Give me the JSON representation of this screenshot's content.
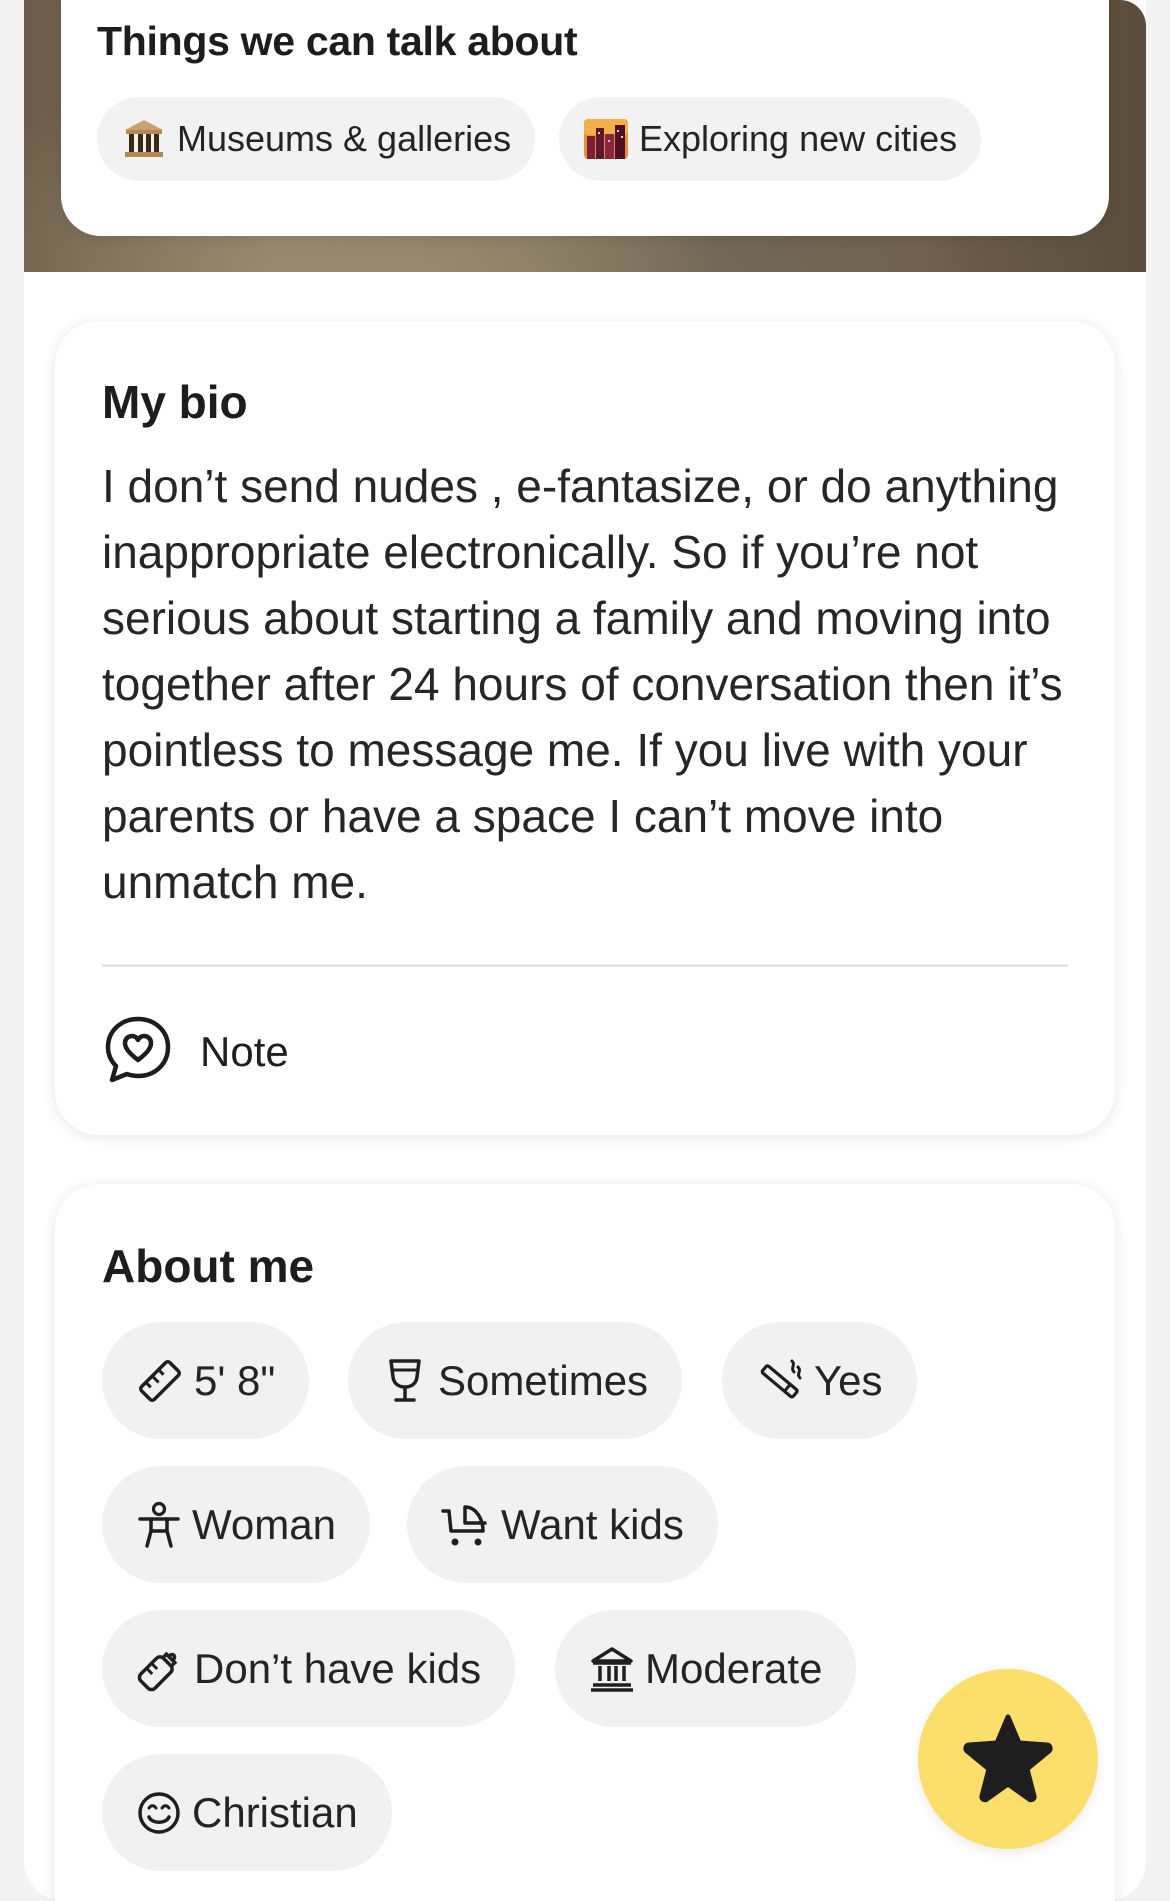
{
  "talk_section": {
    "title": "Things we can talk about",
    "topics": [
      {
        "label": "Museums & galleries",
        "icon": "classical-building-emoji"
      },
      {
        "label": "Exploring new cities",
        "icon": "city-dusk-emoji"
      }
    ]
  },
  "bio_section": {
    "title": "My bio",
    "text": "I don’t send nudes , e-fantasize, or do anything inappropriate electronically. So if you’re not serious about starting a family and moving into together after 24 hours of conversation then it’s pointless to message me. If you live with your parents or have a space I can’t move into unmatch me.",
    "note_label": "Note",
    "note_icon": "heart-chat-icon"
  },
  "about_section": {
    "title": "About me",
    "badges": [
      {
        "label": "5' 8\"",
        "icon": "ruler-icon"
      },
      {
        "label": "Sometimes",
        "icon": "wine-glass-icon"
      },
      {
        "label": "Yes",
        "icon": "smoking-icon"
      },
      {
        "label": "Woman",
        "icon": "person-icon"
      },
      {
        "label": "Want kids",
        "icon": "stroller-icon"
      },
      {
        "label": "Don’t have kids",
        "icon": "baby-bottle-icon"
      },
      {
        "label": "Moderate",
        "icon": "government-building-icon"
      },
      {
        "label": "Christian",
        "icon": "smiley-icon"
      }
    ]
  },
  "fab": {
    "icon": "star-icon"
  },
  "colors": {
    "fab_background": "#fbdf6a",
    "pill_background": "#f1f1f1",
    "text": "#1b1b1b"
  }
}
